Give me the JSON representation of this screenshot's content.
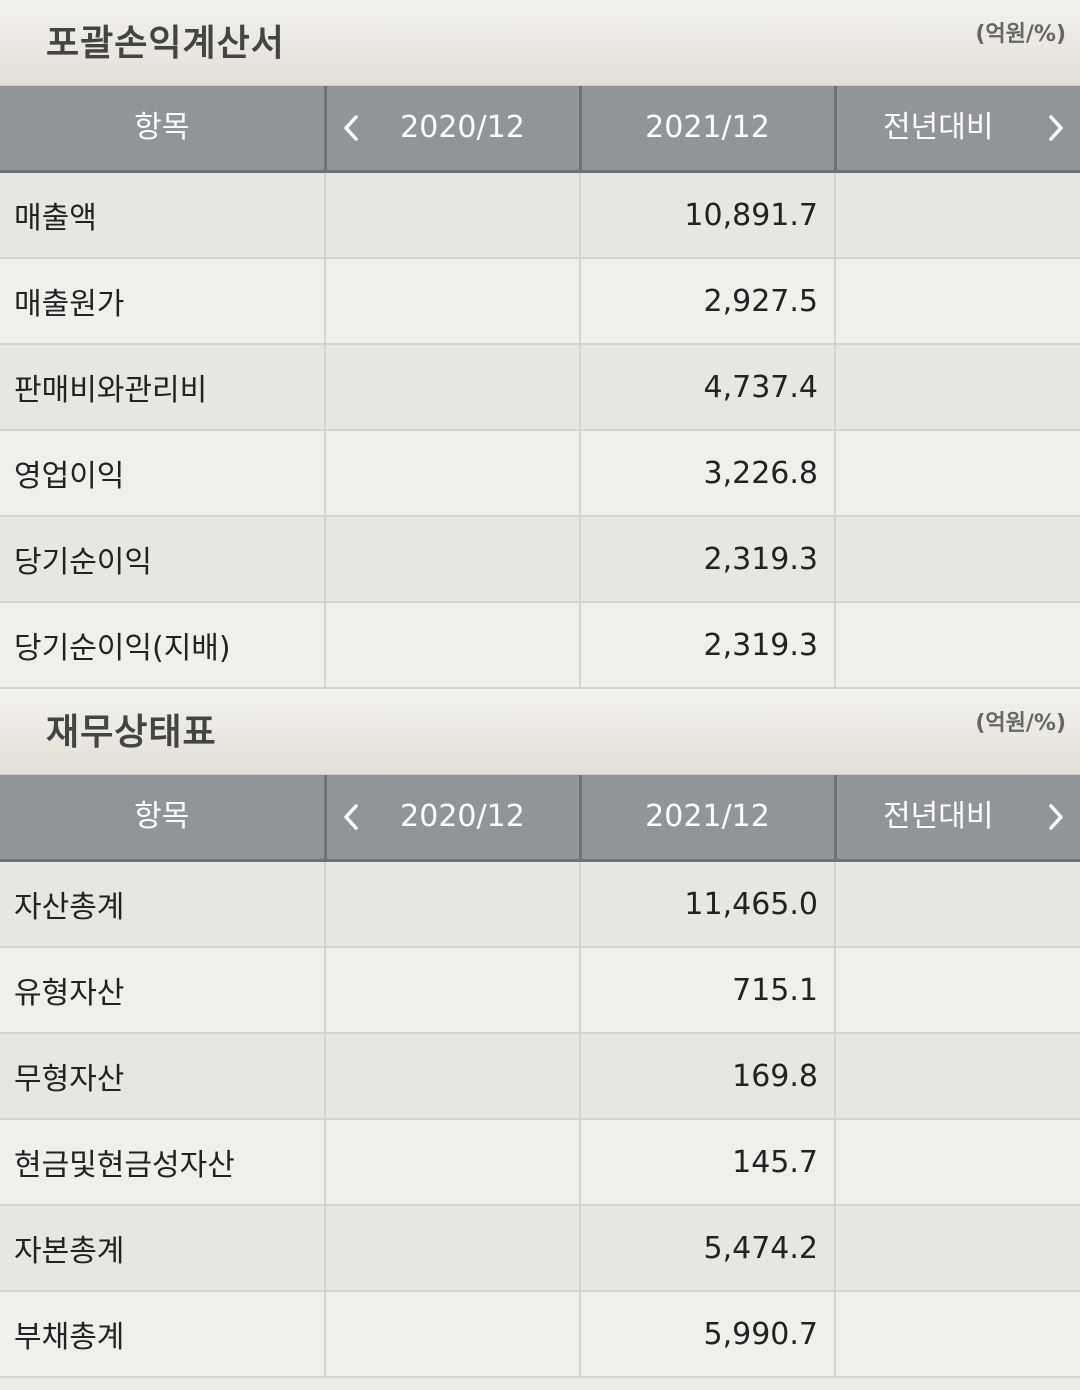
{
  "income": {
    "title": "포괄손익계산서",
    "unit": "(억원/%)",
    "headers": {
      "item": "항목",
      "col1": "2020/12",
      "col2": "2021/12",
      "col3": "전년대비"
    },
    "rows": [
      {
        "label": "매출액",
        "v2020": "",
        "v2021": "10,891.7",
        "yoy": ""
      },
      {
        "label": "매출원가",
        "v2020": "",
        "v2021": "2,927.5",
        "yoy": ""
      },
      {
        "label": "판매비와관리비",
        "v2020": "",
        "v2021": "4,737.4",
        "yoy": ""
      },
      {
        "label": "영업이익",
        "v2020": "",
        "v2021": "3,226.8",
        "yoy": ""
      },
      {
        "label": "당기순이익",
        "v2020": "",
        "v2021": "2,319.3",
        "yoy": ""
      },
      {
        "label": "당기순이익(지배)",
        "v2020": "",
        "v2021": "2,319.3",
        "yoy": ""
      }
    ]
  },
  "balance": {
    "title": "재무상태표",
    "unit": "(억원/%)",
    "headers": {
      "item": "항목",
      "col1": "2020/12",
      "col2": "2021/12",
      "col3": "전년대비"
    },
    "rows": [
      {
        "label": "자산총계",
        "v2020": "",
        "v2021": "11,465.0",
        "yoy": ""
      },
      {
        "label": "유형자산",
        "v2020": "",
        "v2021": "715.1",
        "yoy": ""
      },
      {
        "label": "무형자산",
        "v2020": "",
        "v2021": "169.8",
        "yoy": ""
      },
      {
        "label": "현금및현금성자산",
        "v2020": "",
        "v2021": "145.7",
        "yoy": ""
      },
      {
        "label": "자본총계",
        "v2020": "",
        "v2021": "5,474.2",
        "yoy": ""
      },
      {
        "label": "부채총계",
        "v2020": "",
        "v2021": "5,990.7",
        "yoy": ""
      }
    ]
  },
  "icons": {
    "prev": "chevron-left-icon",
    "next": "chevron-right-icon"
  }
}
